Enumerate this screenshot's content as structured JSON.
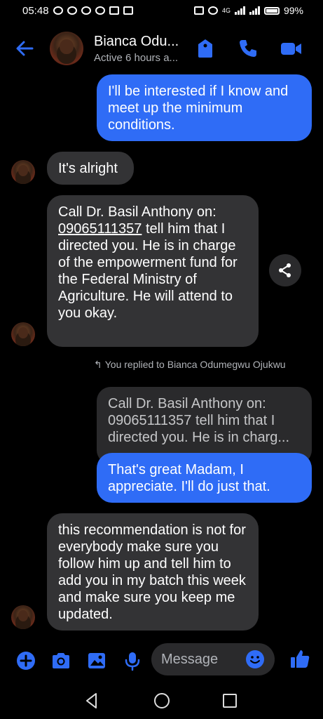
{
  "status_bar": {
    "time": "05:48",
    "network": "4G",
    "battery": "99%"
  },
  "header": {
    "contact_name": "Bianca Odu...",
    "active_status": "Active 6 hours a..."
  },
  "messages": [
    {
      "side": "out",
      "text": "I'll be interested if I know and meet up the minimum conditions."
    },
    {
      "side": "in",
      "text": "It's alright"
    },
    {
      "side": "in",
      "text_before": "Call Dr. Basil Anthony on:",
      "phone": "09065111357",
      "text_after": "tell him that I directed you. He is in charge of the empowerment fund for the Federal Ministry of Agriculture. He will attend to you okay."
    },
    {
      "side": "out",
      "text": "That's great Madam, I appreciate. I'll do just that."
    },
    {
      "side": "in",
      "text": "this recommendation is not for everybody make sure you follow him up and tell him to add you in my batch this week and make sure you keep me updated."
    }
  ],
  "reply_note": "You replied to Bianca Odumegwu Ojukwu",
  "quoted_text": "Call Dr. Basil Anthony on: 09065111357 tell him that I directed you. He is in charg...",
  "composer": {
    "placeholder": "Message"
  },
  "colors": {
    "accent": "#2f6cf6",
    "incoming_bubble": "#333335",
    "background": "#000000"
  }
}
